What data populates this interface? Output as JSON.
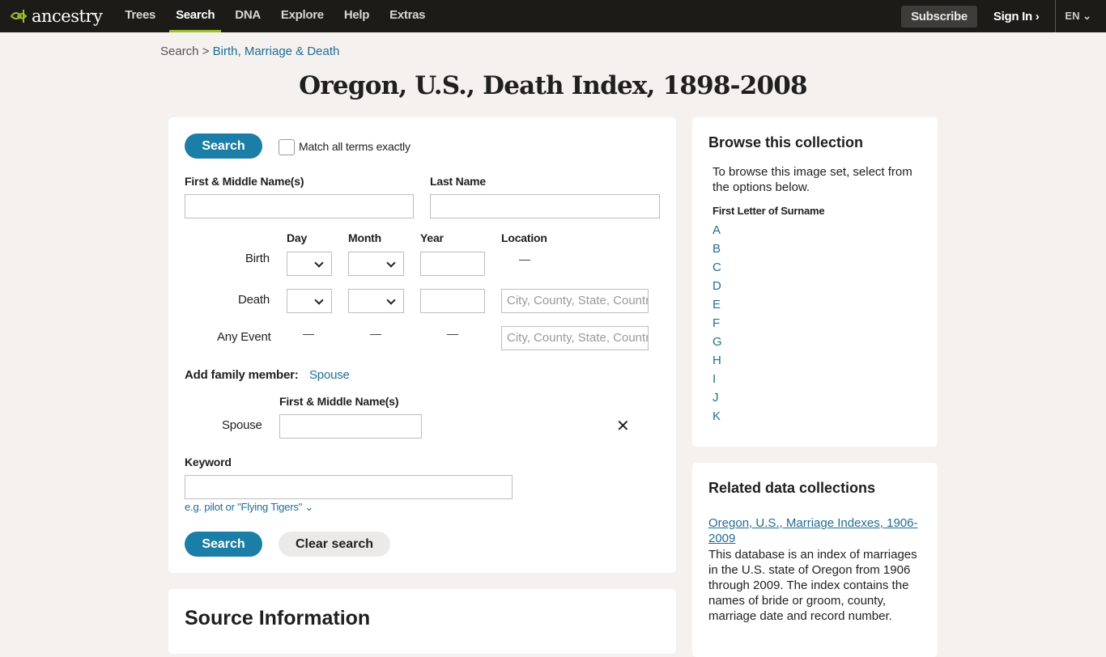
{
  "nav": {
    "logo": "ancestry",
    "items": [
      "Trees",
      "Search",
      "DNA",
      "Explore",
      "Help",
      "Extras"
    ],
    "active": "Search",
    "subscribe": "Subscribe",
    "signin": "Sign In",
    "lang": "EN",
    "accent": "#9cbe30"
  },
  "breadcrumb": {
    "root": "Search",
    "sep": " > ",
    "current": "Birth, Marriage & Death"
  },
  "title": "Oregon, U.S., Death Index, 1898-2008",
  "form": {
    "search": "Search",
    "match_exact": "Match all terms exactly",
    "first_name": "First & Middle Name(s)",
    "last_name": "Last Name",
    "cols": {
      "day": "Day",
      "month": "Month",
      "year": "Year",
      "location": "Location"
    },
    "rows": {
      "birth": "Birth",
      "death": "Death",
      "any": "Any Event"
    },
    "location_placeholder": "City, County, State, Country",
    "add_family": "Add family member:",
    "spouse_link": "Spouse",
    "spouse_label": "Spouse",
    "spouse_name_label": "First & Middle Name(s)",
    "keyword": "Keyword",
    "keyword_hint": "e.g. pilot or \"Flying Tigers\"",
    "clear": "Clear search",
    "button_color": "#1a7ea6"
  },
  "source": {
    "title": "Source Information"
  },
  "browse": {
    "title": "Browse this collection",
    "desc": "To browse this image set, select from the options below.",
    "sub": "First Letter of Surname",
    "letters": [
      "A",
      "B",
      "C",
      "D",
      "E",
      "F",
      "G",
      "H",
      "I",
      "J",
      "K"
    ]
  },
  "related": {
    "title": "Related data collections",
    "link": "Oregon, U.S., Marriage Indexes, 1906-2009",
    "desc": "This database is an index of marriages in the U.S. state of Oregon from 1906 through 2009. The index contains the names of bride or groom, county, marriage date and record number."
  }
}
